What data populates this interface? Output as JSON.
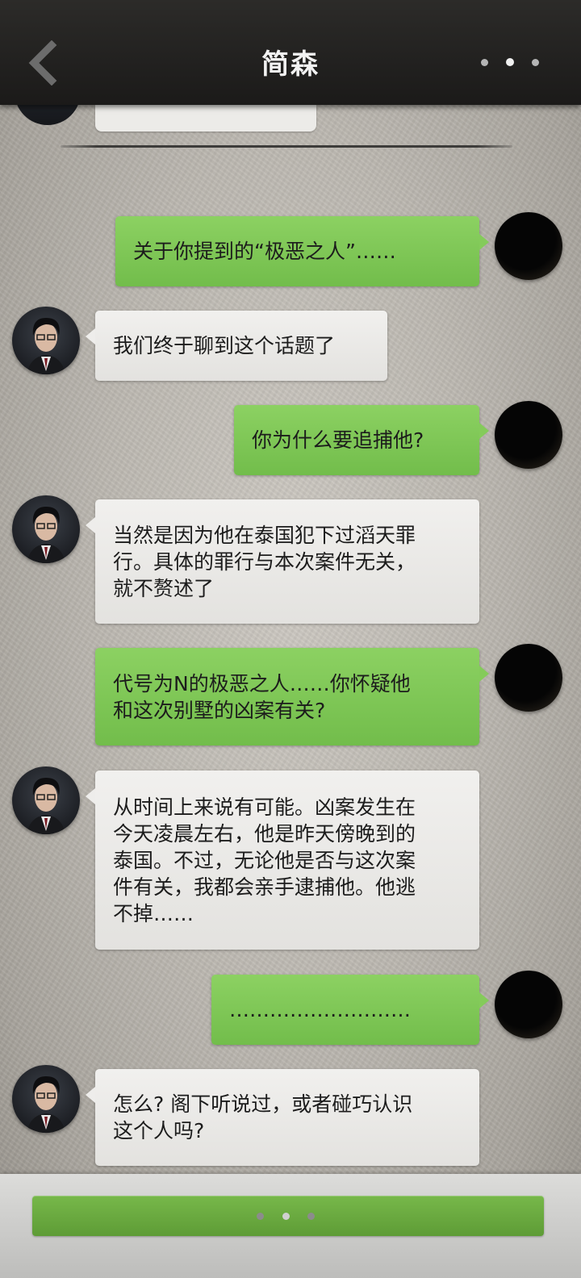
{
  "header": {
    "title": "简森",
    "back_icon": "chevron-left-icon",
    "more_icon": "more-dots-icon"
  },
  "messages": [
    {
      "sender": "me",
      "text": "关于你提到的“极恶之人”……"
    },
    {
      "sender": "npc",
      "text": "我们终于聊到这个话题了"
    },
    {
      "sender": "me",
      "text": "你为什么要追捕他?"
    },
    {
      "sender": "npc",
      "text": "当然是因为他在泰国犯下过滔天罪\n行。具体的罪行与本次案件无关，\n就不赘述了"
    },
    {
      "sender": "me",
      "text": "代号为N的极恶之人……你怀疑他\n和这次别墅的凶案有关?"
    },
    {
      "sender": "npc",
      "text": "从时间上来说有可能。凶案发生在\n今天凌晨左右，他是昨天傍晚到的\n泰国。不过，无论他是否与这次案\n件有关，我都会亲手逮捕他。他逃\n不掉……"
    },
    {
      "sender": "me",
      "text": "………………………"
    },
    {
      "sender": "npc",
      "text": "怎么? 阁下听说过，或者碰巧认识\n这个人吗?"
    }
  ],
  "input": {
    "indicator": "typing-dots"
  },
  "colors": {
    "player_bubble": "#7fc756",
    "npc_bubble": "#eae9e6",
    "header_bg": "#222120",
    "input_button": "#6aaa40"
  }
}
